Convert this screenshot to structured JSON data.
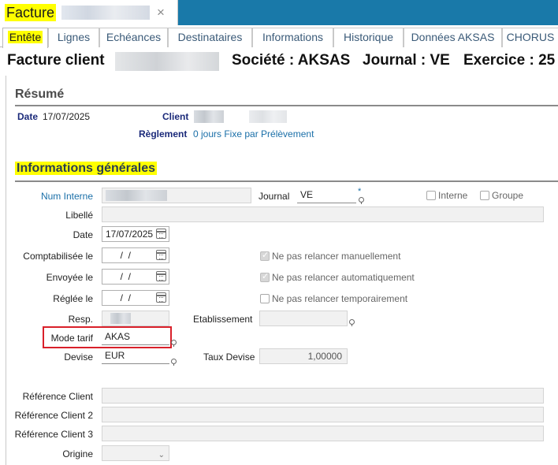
{
  "window": {
    "doc_tab_title": "Facture",
    "close_glyph": "×"
  },
  "tabs": [
    {
      "label": "Entête",
      "active": true
    },
    {
      "label": "Lignes"
    },
    {
      "label": "Echéances"
    },
    {
      "label": "Destinataires"
    },
    {
      "label": "Informations"
    },
    {
      "label": "Historique"
    },
    {
      "label": "Données AKSAS"
    },
    {
      "label": "CHORUS"
    }
  ],
  "header": {
    "title": "Facture client",
    "societe": "Société : AKSAS",
    "journal": "Journal : VE",
    "exercice": "Exercice : 25"
  },
  "resume": {
    "title": "Résumé",
    "date_label": "Date",
    "date_value": "17/07/2025",
    "client_label": "Client",
    "reglement_label": "Règlement",
    "reglement_value": "0 jours Fixe par Prélèvement"
  },
  "infos": {
    "title": "Informations générales",
    "num_interne_label": "Num Interne",
    "journal_label": "Journal",
    "journal_value": "VE",
    "required_mark": "*",
    "interne_label": "Interne",
    "groupe_label": "Groupe",
    "libelle_label": "Libellé",
    "libelle_value": "",
    "date_label": "Date",
    "date_value": "17/07/2025",
    "comptabilisee_label": "Comptabilisée le",
    "comptabilisee_value": "  /  /",
    "envoyee_label": "Envoyée le",
    "envoyee_value": "  /  /",
    "reglee_label": "Réglée le",
    "reglee_value": "  /  /",
    "ne_pas_relancer_manuel": "Ne pas relancer manuellement",
    "ne_pas_relancer_auto": "Ne pas relancer automatiquement",
    "ne_pas_relancer_temp": "Ne pas relancer temporairement",
    "resp_label": "Resp.",
    "etablissement_label": "Etablissement",
    "etablissement_value": "",
    "mode_tarif_label": "Mode tarif",
    "mode_tarif_value": "AKAS",
    "devise_label": "Devise",
    "devise_value": "EUR",
    "taux_devise_label": "Taux Devise",
    "taux_devise_value": "1,00000",
    "ref_client_label": "Référence Client",
    "ref_client_2_label": "Référence Client 2",
    "ref_client_3_label": "Référence Client 3",
    "origine_label": "Origine",
    "origine_value": ""
  },
  "checks": {
    "ne_pas_relancer_manuel": true,
    "ne_pas_relancer_auto": true,
    "ne_pas_relancer_temp": false,
    "interne": false,
    "groupe": false
  },
  "colors": {
    "topbar": "#1979a9",
    "highlight": "#ffff00",
    "link": "#1a6fa8",
    "focus_box": "#d9202a"
  }
}
